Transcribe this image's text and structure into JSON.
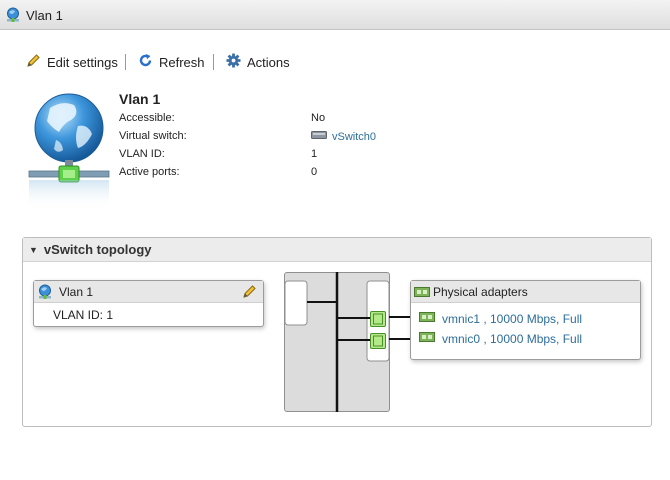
{
  "window": {
    "title": "Vlan 1",
    "icon": "portgroup-icon"
  },
  "toolbar": {
    "edit_label": "Edit settings",
    "refresh_label": "Refresh",
    "actions_label": "Actions"
  },
  "summary": {
    "name": "Vlan 1",
    "properties": [
      {
        "label": "Accessible:",
        "value": "No"
      },
      {
        "label": "Virtual switch:",
        "value": "vSwitch0"
      },
      {
        "label": "VLAN ID:",
        "value": "1"
      },
      {
        "label": "Active ports:",
        "value": "0"
      }
    ]
  },
  "topology": {
    "title": "vSwitch topology",
    "portgroup": {
      "name": "Vlan 1",
      "vlan_text": "VLAN ID: 1"
    },
    "adapters": {
      "title": "Physical adapters",
      "items": [
        {
          "label": "vmnic1 , 10000 Mbps, Full"
        },
        {
          "label": "vmnic0 , 10000 Mbps, Full"
        }
      ]
    }
  },
  "colors": {
    "link": "#2c6e9b",
    "accent_blue": "#2a6fc9",
    "port_green": "#a8e07a",
    "header_gray": "#ececec"
  }
}
